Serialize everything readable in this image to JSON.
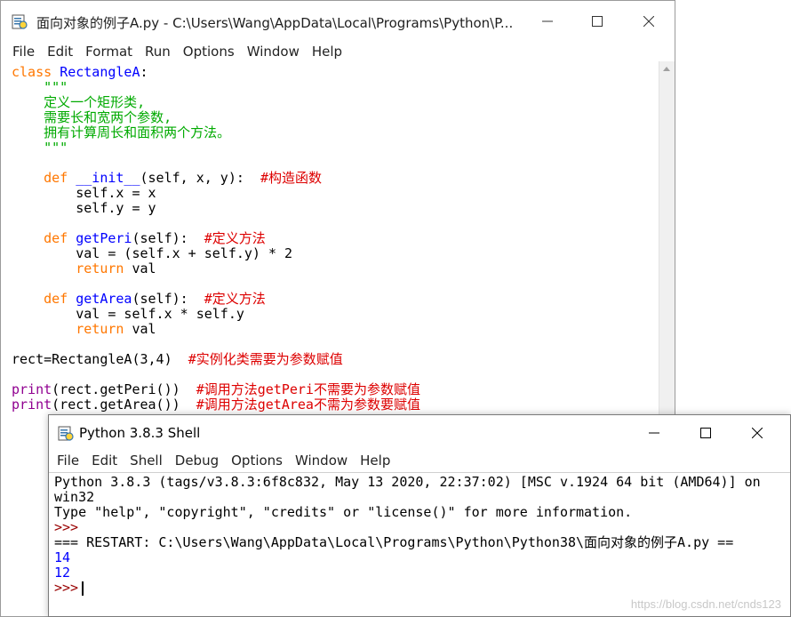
{
  "editor": {
    "title": "面向对象的例子A.py - C:\\Users\\Wang\\AppData\\Local\\Programs\\Python\\P...",
    "menu": [
      "File",
      "Edit",
      "Format",
      "Run",
      "Options",
      "Window",
      "Help"
    ],
    "code": {
      "l1_kw": "class",
      "l1_name": "RectangleA",
      "l1_rest": ":",
      "l2": "    \"\"\"",
      "l3": "    定义一个矩形类,",
      "l4": "    需要长和宽两个参数,",
      "l5": "    拥有计算周长和面积两个方法。",
      "l6": "    \"\"\"",
      "l8_kw": "def",
      "l8_name": "__init__",
      "l8_rest": "(self, x, y):  ",
      "l8_cmt": "#构造函数",
      "l9": "        self.x = x",
      "l10": "        self.y = y",
      "l12_kw": "def",
      "l12_name": "getPeri",
      "l12_rest": "(self):  ",
      "l12_cmt": "#定义方法",
      "l13": "        val = (self.x + self.y) * 2",
      "l14_kw": "return",
      "l14_rest": " val",
      "l16_kw": "def",
      "l16_name": "getArea",
      "l16_rest": "(self):  ",
      "l16_cmt": "#定义方法",
      "l17": "        val = self.x * self.y",
      "l18_kw": "return",
      "l18_rest": " val",
      "l20": "rect=RectangleA(3,4)  ",
      "l20_cmt": "#实例化类需要为参数赋值",
      "l22_bi": "print",
      "l22_rest": "(rect.getPeri())  ",
      "l22_cmt": "#调用方法getPeri不需要为参数赋值",
      "l23_bi": "print",
      "l23_rest": "(rect.getArea())  ",
      "l23_cmt": "#调用方法getArea不需为参数要赋值"
    }
  },
  "shell": {
    "title": "Python 3.8.3 Shell",
    "menu": [
      "File",
      "Edit",
      "Shell",
      "Debug",
      "Options",
      "Window",
      "Help"
    ],
    "lines": {
      "banner1": "Python 3.8.3 (tags/v3.8.3:6f8c832, May 13 2020, 22:37:02) [MSC v.1924 64 bit (AMD64)] on",
      "banner2": "win32",
      "banner3": "Type \"help\", \"copyright\", \"credits\" or \"license()\" for more information.",
      "prompt1": ">>>",
      "restart": "=== RESTART: C:\\Users\\Wang\\AppData\\Local\\Programs\\Python\\Python38\\面向对象的例子A.py ==",
      "out1": "14",
      "out2": "12",
      "prompt2": ">>>"
    }
  },
  "watermark": "https://blog.csdn.net/cnds123",
  "icons": {
    "app": "python-idle-icon",
    "minimize": "minimize-icon",
    "maximize": "maximize-icon",
    "close": "close-icon"
  }
}
